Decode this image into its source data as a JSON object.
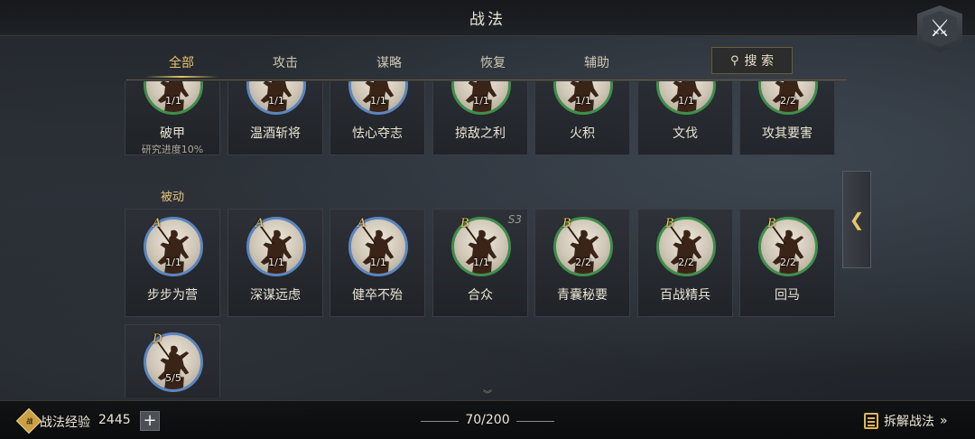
{
  "window": {
    "title": "战法"
  },
  "close_button": {
    "glyph": "⚔"
  },
  "tabs": [
    {
      "label": "全部",
      "active": true
    },
    {
      "label": "攻击",
      "active": false
    },
    {
      "label": "谋略",
      "active": false
    },
    {
      "label": "恢复",
      "active": false
    },
    {
      "label": "辅助",
      "active": false
    }
  ],
  "search": {
    "label": "搜 索"
  },
  "sections": {
    "passive_label": "被动"
  },
  "active_row": [
    {
      "name": "破甲",
      "count": "1/1",
      "ring": "green",
      "progress": "研究进度10%"
    },
    {
      "name": "温酒斩将",
      "count": "1/1",
      "ring": "blue"
    },
    {
      "name": "怯心夺志",
      "count": "1/1",
      "ring": "blue"
    },
    {
      "name": "掠敌之利",
      "count": "1/1",
      "ring": "green"
    },
    {
      "name": "火积",
      "count": "1/1",
      "ring": "green"
    },
    {
      "name": "文伐",
      "count": "1/1",
      "ring": "green"
    },
    {
      "name": "攻其要害",
      "count": "2/2",
      "ring": "green"
    }
  ],
  "passive_row": [
    {
      "name": "步步为营",
      "count": "1/1",
      "grade": "A",
      "ring": "blue"
    },
    {
      "name": "深谋远虑",
      "count": "1/1",
      "grade": "A",
      "ring": "blue"
    },
    {
      "name": "健卒不殆",
      "count": "1/1",
      "grade": "A",
      "ring": "blue"
    },
    {
      "name": "合众",
      "count": "1/1",
      "grade": "B",
      "ring": "green",
      "season": "S3"
    },
    {
      "name": "青囊秘要",
      "count": "2/2",
      "grade": "B",
      "ring": "green"
    },
    {
      "name": "百战精兵",
      "count": "2/2",
      "grade": "B",
      "ring": "green"
    },
    {
      "name": "回马",
      "count": "2/2",
      "grade": "B",
      "ring": "green"
    }
  ],
  "last_row": [
    {
      "name": "",
      "count": "5/5",
      "grade": "D",
      "ring": "blue"
    }
  ],
  "side_tab": {
    "glyph": "❮"
  },
  "bottom": {
    "xp_icon_text": "战",
    "xp_label": "战法经验",
    "xp_value": "2445",
    "plus": "+",
    "capacity": "70/200",
    "dismantle_label": "拆解战法",
    "dismantle_chevron": "»"
  },
  "colors": {
    "accent": "#e8c36a",
    "ring_green": "#3e8f4a",
    "ring_blue": "#5a86c0"
  }
}
